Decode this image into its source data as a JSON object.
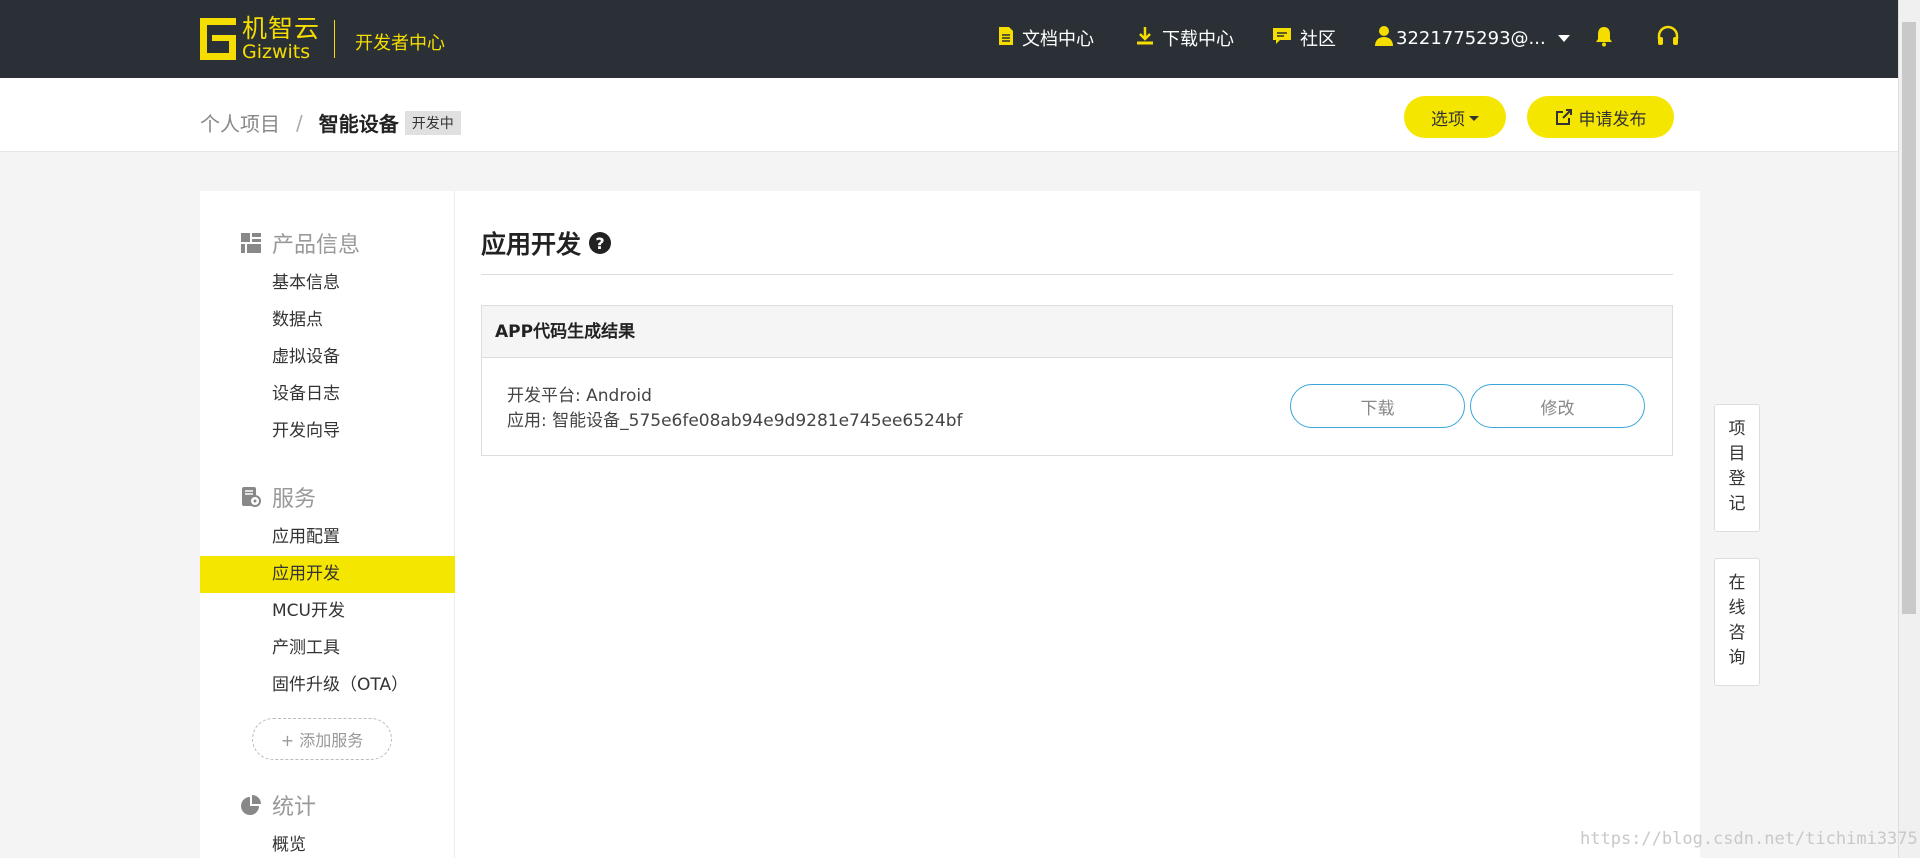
{
  "topbar": {
    "logo_cn": "机智云",
    "logo_en": "Gizwits",
    "dev_center": "开发者中心",
    "nav_docs": "文档中心",
    "nav_download": "下载中心",
    "nav_community": "社区",
    "user": "3221775293@..."
  },
  "subheader": {
    "crumb_parent": "个人项目",
    "crumb_sep": "/",
    "crumb_current": "智能设备",
    "status_badge": "开发中",
    "options_label": "选项",
    "publish_label": "申请发布"
  },
  "sidebar": {
    "sec_product": "产品信息",
    "product_items": [
      "基本信息",
      "数据点",
      "虚拟设备",
      "设备日志",
      "开发向导"
    ],
    "sec_service": "服务",
    "service_items": [
      "应用配置",
      "应用开发",
      "MCU开发",
      "产测工具",
      "固件升级（OTA）"
    ],
    "add_service": "+ 添加服务",
    "sec_stats": "统计",
    "stats_items": [
      "概览"
    ]
  },
  "content": {
    "page_title": "应用开发",
    "panel_title": "APP代码生成结果",
    "platform": "开发平台: Android",
    "app": "应用: 智能设备_575e6fe08ab94e9d9281e745ee6524bf",
    "download_label": "下载",
    "edit_label": "修改"
  },
  "float_tabs": {
    "register": "项目登记",
    "consult": "在线咨询"
  },
  "watermark": "https://blog.csdn.net/tichimi3375",
  "colors": {
    "brand_yellow": "#f5e600",
    "topbar_bg": "#2b3036",
    "outline_blue": "#3aa6d8"
  }
}
